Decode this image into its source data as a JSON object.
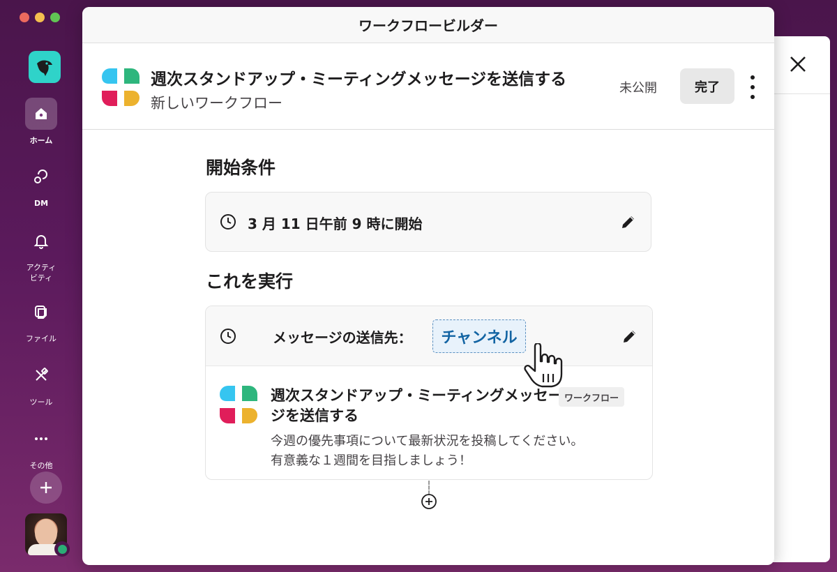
{
  "window": {
    "title": "ワークフロービルダー"
  },
  "rail": {
    "items": [
      {
        "label": "ホーム",
        "icon": "home-icon",
        "active": true
      },
      {
        "label": "DM",
        "icon": "dm-icon",
        "active": false
      },
      {
        "label": "アクティ\nビティ",
        "icon": "bell-icon",
        "active": false
      },
      {
        "label": "ファイル",
        "icon": "files-icon",
        "active": false
      },
      {
        "label": "ツール",
        "icon": "tools-icon",
        "active": false
      },
      {
        "label": "その他",
        "icon": "more-icon",
        "active": false
      }
    ]
  },
  "workflow": {
    "title": "週次スタンドアップ・ミーティングメッセージを送信する",
    "subtitle": "新しいワークフロー",
    "status": "未公開",
    "done_label": "完了"
  },
  "trigger": {
    "heading": "開始条件",
    "text": "3 月 11 日午前 9 時に開始"
  },
  "action": {
    "heading": "これを実行",
    "label": "メッセージの送信先：",
    "channel": "チャンネル",
    "message": {
      "title": "週次スタンドアップ・ミーティングメッセージを送信する",
      "badge": "ワークフロー",
      "body_line1": "今週の優先事項について最新状況を投稿してください。",
      "body_line2": "有意義な１週間を目指しましょう！"
    }
  },
  "colors": {
    "sidebar": "#4a154b",
    "accent_blue": "#1264a3",
    "logo_cyan": "#36c5f0",
    "logo_green": "#2eb67d",
    "logo_red": "#e01e5a",
    "logo_yellow": "#ecb22e"
  }
}
